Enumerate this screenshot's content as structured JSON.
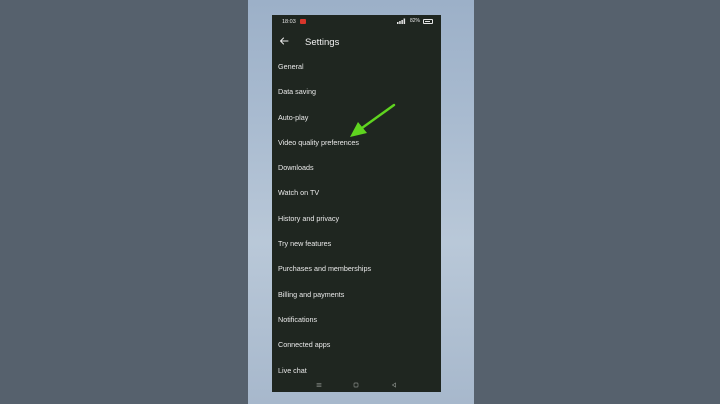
{
  "status_bar": {
    "time": "18:03",
    "battery_percent_text": "82%",
    "battery_level": 0.82,
    "accent_color": "#d8362b"
  },
  "header": {
    "back_icon": "arrow-left-icon",
    "title": "Settings"
  },
  "menu": {
    "items": [
      {
        "label": "General"
      },
      {
        "label": "Data saving"
      },
      {
        "label": "Auto-play"
      },
      {
        "label": "Video quality preferences"
      },
      {
        "label": "Downloads"
      },
      {
        "label": "Watch on TV"
      },
      {
        "label": "History and privacy"
      },
      {
        "label": "Try new features"
      },
      {
        "label": "Purchases and memberships"
      },
      {
        "label": "Billing and payments"
      },
      {
        "label": "Notifications"
      },
      {
        "label": "Connected apps"
      },
      {
        "label": "Live chat"
      }
    ]
  },
  "nav_bar": {
    "menu_icon": "menu-icon",
    "home_icon": "square-home-icon",
    "back_icon": "triangle-back-icon"
  },
  "annotation": {
    "arrow_color": "#5fd41f",
    "points_to": "Video quality preferences"
  },
  "theme": {
    "phone_background": "#1f2620",
    "page_background": "#55606c",
    "text_color": "#eaeaea"
  }
}
